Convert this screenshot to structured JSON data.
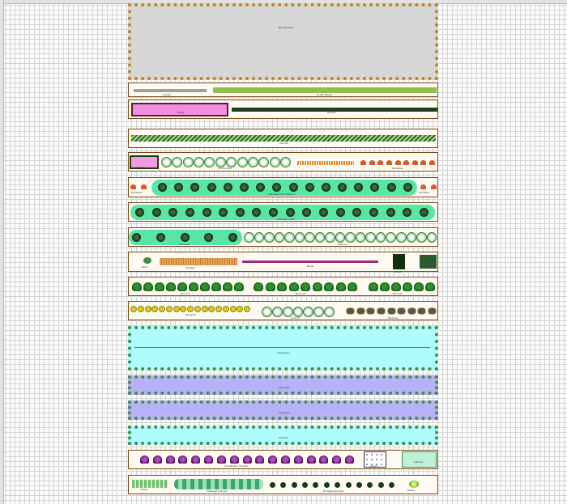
{
  "beds": {
    "b1": {
      "label": "Bed Borders"
    },
    "b2": {
      "label_a": "Chives",
      "label_b": "Green Beans"
    },
    "b3": {
      "label_a": "Beets",
      "label_b": "Onions"
    },
    "b4": {
      "label": "Carrots"
    },
    "b5": {
      "label_a": "Lettuce",
      "label_b": "Chamomile",
      "label_c": "Radishes"
    },
    "b6": {
      "label_a": "Radishes",
      "label_b": "Cabbage (Mid Season)",
      "label_c": "Radishes"
    },
    "b7": {
      "label": "Cabbage (Late)"
    },
    "b8": {
      "label_a": "Cabbage",
      "label_b": "Lettuce"
    },
    "b9": {
      "label_a": "Basil",
      "label_b": "Squash",
      "label_c": "Beets",
      "label_d": "Onion"
    },
    "b10": {
      "label_a": "Broccoli",
      "label_b": "Broccoli",
      "label_c": "Broccoli"
    },
    "b11": {
      "label_a": "Marigold",
      "label_b": "Lettuce",
      "label_c": "Potatoes"
    },
    "b12": {
      "label": "Asparagus"
    },
    "b13": {
      "label": "Lavender"
    },
    "b14": {
      "label": "Lavender"
    },
    "b15": {
      "label": "Spinach"
    },
    "b16": {
      "label_a": "Cauliflower (Purple)",
      "label_b": "Chard",
      "label_c": "Lettuce"
    },
    "b17": {
      "label_a": "Celery",
      "label_b": "Cabbage (Savoy)",
      "label_c": "Brussels Sprouts",
      "label_d": "Herbs"
    }
  }
}
